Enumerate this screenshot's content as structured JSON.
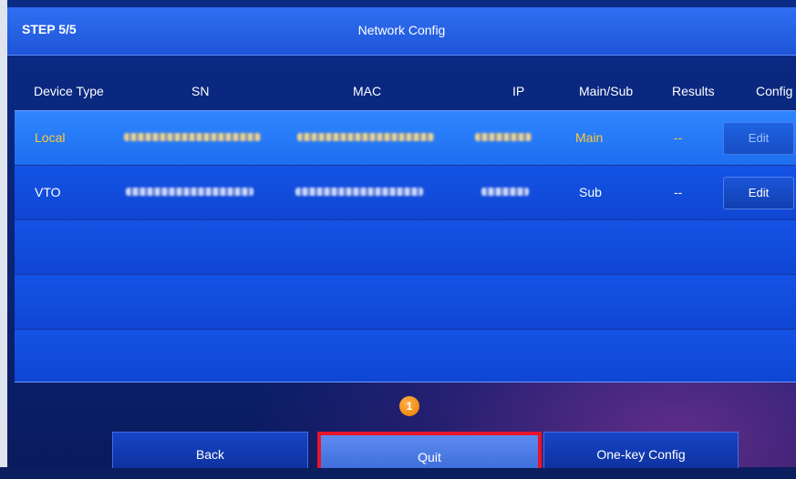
{
  "header": {
    "step": "STEP 5/5",
    "title": "Network Config"
  },
  "columns": [
    "Device Type",
    "SN",
    "MAC",
    "IP",
    "Main/Sub",
    "Results",
    "Config"
  ],
  "rows": [
    {
      "device_type": "Local",
      "main_sub": "Main",
      "results": "--",
      "config": "Edit",
      "selected": true
    },
    {
      "device_type": "VTO",
      "main_sub": "Sub",
      "results": "--",
      "config": "Edit",
      "selected": false
    }
  ],
  "badge": "1",
  "buttons": {
    "back": "Back",
    "quit": "Quit",
    "one_key": "One-key Config"
  },
  "colors": {
    "highlight_text": "#ffc83a",
    "annotation_box": "#e8142a",
    "badge": "#f08a12"
  }
}
